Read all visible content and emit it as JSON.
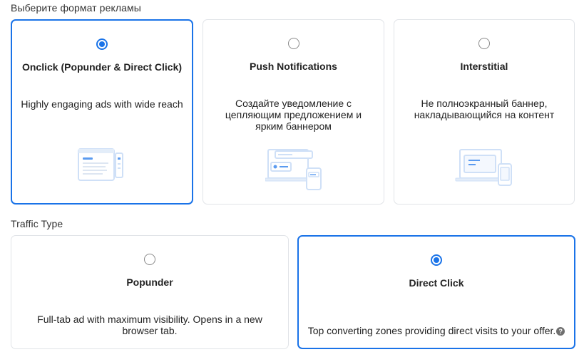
{
  "ad_format": {
    "heading": "Выберите формат рекламы",
    "options": [
      {
        "title": "Onclick (Popunder & Direct Click)",
        "description": "Highly engaging ads with wide reach",
        "selected": true,
        "illustration": "popunder-window-illustration"
      },
      {
        "title": "Push Notifications",
        "description": "Создайте уведомление с цепляющим предложением и ярким баннером",
        "selected": false,
        "illustration": "push-notification-illustration"
      },
      {
        "title": "Interstitial",
        "description": "Не полноэкранный баннер, накладывающийся на контент",
        "selected": false,
        "illustration": "interstitial-illustration"
      }
    ]
  },
  "traffic_type": {
    "heading": "Traffic Type",
    "options": [
      {
        "title": "Popunder",
        "description": "Full-tab ad with maximum visibility. Opens in a new browser tab.",
        "selected": false
      },
      {
        "title": "Direct Click",
        "description": "Top converting zones providing direct visits to your offer.",
        "selected": true,
        "help_icon": "?"
      }
    ]
  },
  "colors": {
    "accent": "#1a73e8",
    "border": "#e1e4e8",
    "illustration": "#cfe0f7"
  }
}
